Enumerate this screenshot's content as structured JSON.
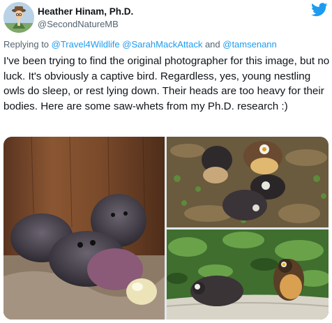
{
  "author": {
    "display_name": "Heather Hinam, Ph.D.",
    "handle": "@SecondNatureMB"
  },
  "reply": {
    "prefix": "Replying to ",
    "mentions": [
      "@Travel4Wildlife",
      "@SarahMackAttack"
    ],
    "joiner": " and ",
    "last_mention": "@tamsenann"
  },
  "tweet_text": "I've been trying to find the original photographer for this image, but no luck. It's obviously a captive bird. Regardless, yes, young nestling owls do sleep, or rest lying down. Their heads are too heavy for their bodies. Here are some saw-whets from my Ph.D. research :)",
  "icons": {
    "brand": "twitter-bird-icon",
    "brand_color": "#1d9bf0",
    "avatar": "avatar-cartoon"
  },
  "colors": {
    "text": "#0f1419",
    "secondary": "#536471",
    "link": "#1d9bf0"
  }
}
